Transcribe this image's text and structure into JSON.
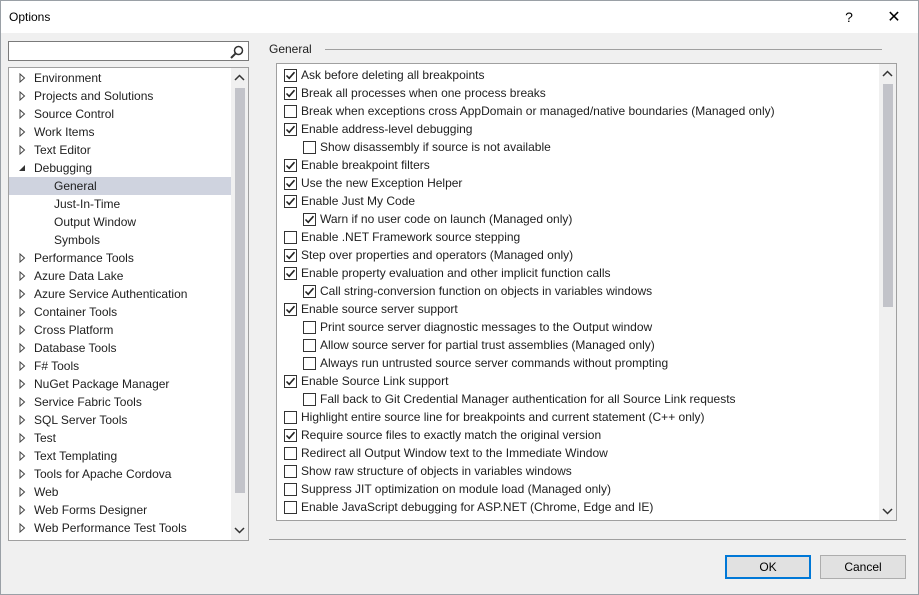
{
  "window": {
    "title": "Options",
    "help_glyph": "?",
    "close_glyph": "✕"
  },
  "search": {
    "value": "",
    "placeholder": ""
  },
  "tree": {
    "items": [
      {
        "label": "Environment",
        "level": 0,
        "expander": "collapsed"
      },
      {
        "label": "Projects and Solutions",
        "level": 0,
        "expander": "collapsed"
      },
      {
        "label": "Source Control",
        "level": 0,
        "expander": "collapsed"
      },
      {
        "label": "Work Items",
        "level": 0,
        "expander": "collapsed"
      },
      {
        "label": "Text Editor",
        "level": 0,
        "expander": "collapsed"
      },
      {
        "label": "Debugging",
        "level": 0,
        "expander": "expanded"
      },
      {
        "label": "General",
        "level": 1,
        "expander": "none",
        "selected": true
      },
      {
        "label": "Just-In-Time",
        "level": 1,
        "expander": "none"
      },
      {
        "label": "Output Window",
        "level": 1,
        "expander": "none"
      },
      {
        "label": "Symbols",
        "level": 1,
        "expander": "none"
      },
      {
        "label": "Performance Tools",
        "level": 0,
        "expander": "collapsed"
      },
      {
        "label": "Azure Data Lake",
        "level": 0,
        "expander": "collapsed"
      },
      {
        "label": "Azure Service Authentication",
        "level": 0,
        "expander": "collapsed"
      },
      {
        "label": "Container Tools",
        "level": 0,
        "expander": "collapsed"
      },
      {
        "label": "Cross Platform",
        "level": 0,
        "expander": "collapsed"
      },
      {
        "label": "Database Tools",
        "level": 0,
        "expander": "collapsed"
      },
      {
        "label": "F# Tools",
        "level": 0,
        "expander": "collapsed"
      },
      {
        "label": "NuGet Package Manager",
        "level": 0,
        "expander": "collapsed"
      },
      {
        "label": "Service Fabric Tools",
        "level": 0,
        "expander": "collapsed"
      },
      {
        "label": "SQL Server Tools",
        "level": 0,
        "expander": "collapsed"
      },
      {
        "label": "Test",
        "level": 0,
        "expander": "collapsed"
      },
      {
        "label": "Text Templating",
        "level": 0,
        "expander": "collapsed"
      },
      {
        "label": "Tools for Apache Cordova",
        "level": 0,
        "expander": "collapsed"
      },
      {
        "label": "Web",
        "level": 0,
        "expander": "collapsed"
      },
      {
        "label": "Web Forms Designer",
        "level": 0,
        "expander": "collapsed"
      },
      {
        "label": "Web Performance Test Tools",
        "level": 0,
        "expander": "collapsed"
      }
    ]
  },
  "section": {
    "title": "General"
  },
  "options": [
    {
      "label": "Ask before deleting all breakpoints",
      "checked": true,
      "indent": 0
    },
    {
      "label": "Break all processes when one process breaks",
      "checked": true,
      "indent": 0
    },
    {
      "label": "Break when exceptions cross AppDomain or managed/native boundaries (Managed only)",
      "checked": false,
      "indent": 0
    },
    {
      "label": "Enable address-level debugging",
      "checked": true,
      "indent": 0
    },
    {
      "label": "Show disassembly if source is not available",
      "checked": false,
      "indent": 1
    },
    {
      "label": "Enable breakpoint filters",
      "checked": true,
      "indent": 0
    },
    {
      "label": "Use the new Exception Helper",
      "checked": true,
      "indent": 0
    },
    {
      "label": "Enable Just My Code",
      "checked": true,
      "indent": 0
    },
    {
      "label": "Warn if no user code on launch (Managed only)",
      "checked": true,
      "indent": 1
    },
    {
      "label": "Enable .NET Framework source stepping",
      "checked": false,
      "indent": 0
    },
    {
      "label": "Step over properties and operators (Managed only)",
      "checked": true,
      "indent": 0
    },
    {
      "label": "Enable property evaluation and other implicit function calls",
      "checked": true,
      "indent": 0
    },
    {
      "label": "Call string-conversion function on objects in variables windows",
      "checked": true,
      "indent": 1
    },
    {
      "label": "Enable source server support",
      "checked": true,
      "indent": 0
    },
    {
      "label": "Print source server diagnostic messages to the Output window",
      "checked": false,
      "indent": 1
    },
    {
      "label": "Allow source server for partial trust assemblies (Managed only)",
      "checked": false,
      "indent": 1
    },
    {
      "label": "Always run untrusted source server commands without prompting",
      "checked": false,
      "indent": 1
    },
    {
      "label": "Enable Source Link support",
      "checked": true,
      "indent": 0
    },
    {
      "label": "Fall back to Git Credential Manager authentication for all Source Link requests",
      "checked": false,
      "indent": 1
    },
    {
      "label": "Highlight entire source line for breakpoints and current statement (C++ only)",
      "checked": false,
      "indent": 0
    },
    {
      "label": "Require source files to exactly match the original version",
      "checked": true,
      "indent": 0
    },
    {
      "label": "Redirect all Output Window text to the Immediate Window",
      "checked": false,
      "indent": 0
    },
    {
      "label": "Show raw structure of objects in variables windows",
      "checked": false,
      "indent": 0
    },
    {
      "label": "Suppress JIT optimization on module load (Managed only)",
      "checked": false,
      "indent": 0
    },
    {
      "label": "Enable JavaScript debugging for ASP.NET (Chrome, Edge and IE)",
      "checked": false,
      "indent": 0
    }
  ],
  "buttons": {
    "ok": "OK",
    "cancel": "Cancel"
  }
}
